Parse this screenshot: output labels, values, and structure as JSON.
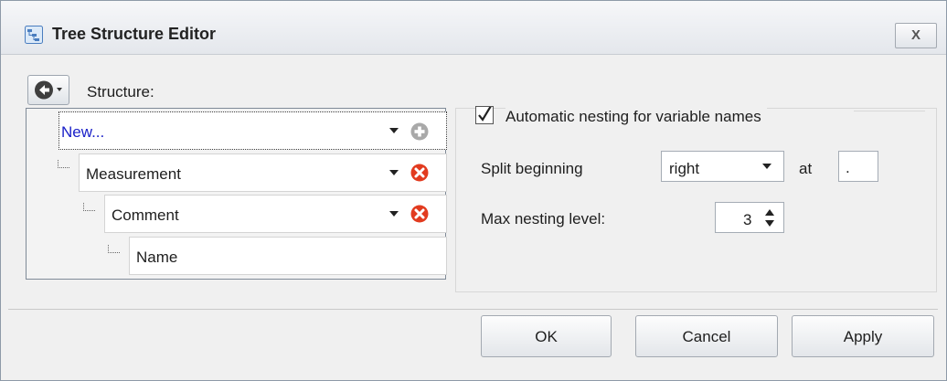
{
  "window": {
    "title": "Tree Structure Editor",
    "close_label": "X"
  },
  "structure": {
    "label": "Structure:",
    "nodes": [
      {
        "label": "New...",
        "action": "add-icon"
      },
      {
        "label": "Measurement",
        "action": "remove-icon"
      },
      {
        "label": "Comment",
        "action": "remove-icon"
      },
      {
        "label": "Name",
        "action": null
      }
    ]
  },
  "settings": {
    "auto_nesting": {
      "label": "Automatic nesting for variable names",
      "checked": true
    },
    "split": {
      "label": "Split beginning",
      "value": "right"
    },
    "at": {
      "label": "at",
      "value": "."
    },
    "max_nesting": {
      "label": "Max nesting level:",
      "value": "3"
    }
  },
  "buttons": {
    "ok": "OK",
    "cancel": "Cancel",
    "apply": "Apply"
  },
  "colors": {
    "remove_icon": "#e23b1f",
    "add_icon": "#a9a9a9",
    "new_item_text": "#1a20c8"
  }
}
